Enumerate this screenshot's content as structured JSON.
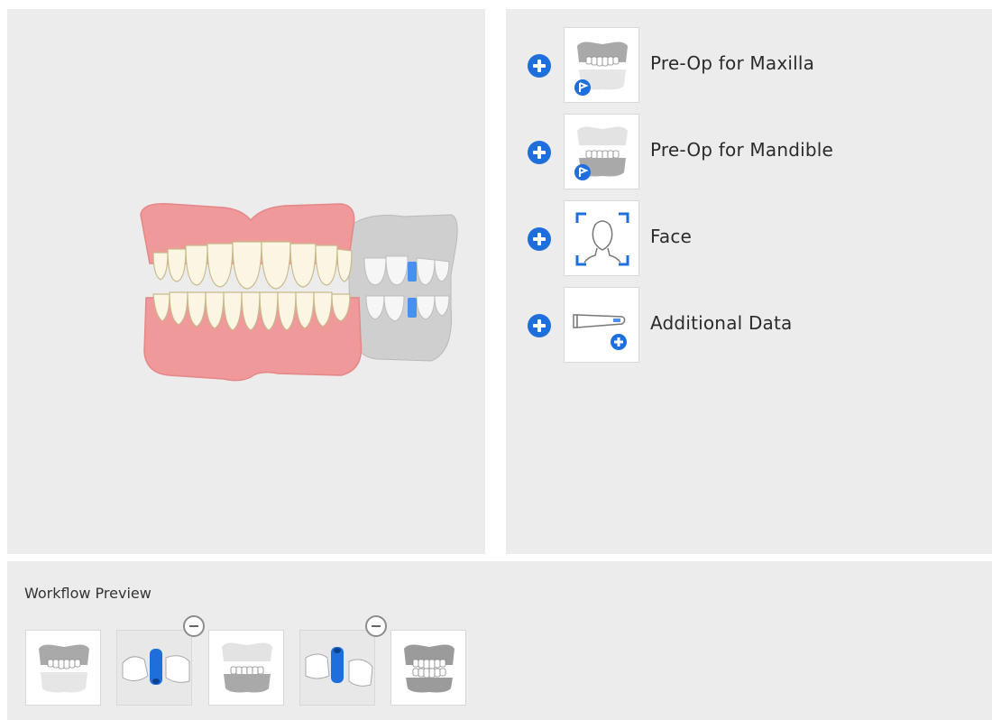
{
  "data_items": [
    {
      "label": "Pre-Op for Maxilla",
      "icon": "maxilla-scan-icon"
    },
    {
      "label": "Pre-Op for Mandible",
      "icon": "mandible-scan-icon"
    },
    {
      "label": "Face",
      "icon": "face-scan-icon"
    },
    {
      "label": "Additional Data",
      "icon": "scanner-add-icon"
    }
  ],
  "workflow": {
    "title": "Workflow Preview",
    "steps": [
      {
        "icon": "upper-jaw-icon"
      },
      {
        "icon": "scan-body-icon",
        "removable": true
      },
      {
        "icon": "lower-jaw-icon"
      },
      {
        "icon": "scan-body-icon",
        "removable": true
      },
      {
        "icon": "occlusion-icon"
      }
    ]
  },
  "colors": {
    "accent": "#1e6fdc",
    "gum": "#f0999a",
    "panel_bg": "#ececec"
  }
}
